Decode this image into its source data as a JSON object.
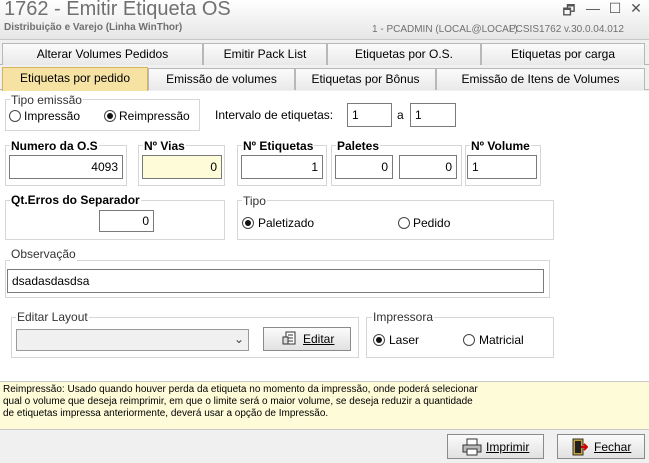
{
  "window": {
    "title": "1762 - Emitir Etiqueta OS",
    "subtitle": "Distribuição e Varejo (Linha WinThor)",
    "connection": "1 - PCADMIN (LOCAL@LOCAL)",
    "version": "PCSIS1762  v.30.0.04.012",
    "controls": {
      "restore": "🗗",
      "minimize": "—",
      "maximize": "☐",
      "close": "✕"
    }
  },
  "tabs_top": [
    {
      "label": "Alterar Volumes Pedidos"
    },
    {
      "label": "Emitir Pack List"
    },
    {
      "label": "Etiquetas por O.S."
    },
    {
      "label": "Etiquetas por carga"
    }
  ],
  "tabs_bottom": [
    {
      "label": "Etiquetas por pedido",
      "active": true
    },
    {
      "label": "Emissão de volumes"
    },
    {
      "label": "Etiquetas por Bônus"
    },
    {
      "label": "Emissão de Itens de Volumes"
    }
  ],
  "tipo_emissao": {
    "label": "Tipo emissão",
    "options": [
      {
        "label": "Impressão",
        "selected": false
      },
      {
        "label": "Reimpressão",
        "selected": true
      }
    ]
  },
  "intervalo": {
    "label": "Intervalo de etiquetas:",
    "from": "1",
    "separator": "a",
    "to": "1"
  },
  "numero_os": {
    "label": "Numero da  O.S",
    "value": "4093"
  },
  "num_vias": {
    "label": "Nº Vias",
    "value": "0"
  },
  "num_etiquetas": {
    "label": "Nº Etiquetas",
    "value": "1"
  },
  "paletes": {
    "label": "Paletes",
    "value1": "0",
    "value2": "0"
  },
  "num_volume": {
    "label": "Nº Volume",
    "value": "1"
  },
  "qt_erros": {
    "label": "Qt.Erros do Separador",
    "value": "0"
  },
  "tipo": {
    "label": "Tipo",
    "options": [
      {
        "label": "Paletizado",
        "selected": true
      },
      {
        "label": "Pedido",
        "selected": false
      }
    ]
  },
  "observacao": {
    "label": "Observação",
    "value": "dsadasdasdsa"
  },
  "editar_layout": {
    "label": "Editar Layout",
    "selected": "",
    "button": "Editar"
  },
  "impressora": {
    "label": "Impressora",
    "options": [
      {
        "label": "Laser",
        "selected": true
      },
      {
        "label": "Matricial",
        "selected": false
      }
    ]
  },
  "hint": {
    "line1": "Reimpressão: Usado quando houver perda da etiqueta no momento da impressão, onde poderá selecionar",
    "line2": "qual o volume que deseja reimprimir, em que o limite será o maior volume, se deseja reduzir a quantidade",
    "line3": "de etiquetas impressa anteriormente, deverá usar a opção de Impressão."
  },
  "footer": {
    "print_button": "Imprimir",
    "close_button": "Fechar"
  },
  "colors": {
    "active_tab": "#f6e3a4",
    "hint_bg": "#fefbd9",
    "readonly_bg": "#fefbd9"
  },
  "icons": {
    "print": "printer-icon",
    "close": "exit-door-icon",
    "edit": "edit-layout-icon"
  }
}
